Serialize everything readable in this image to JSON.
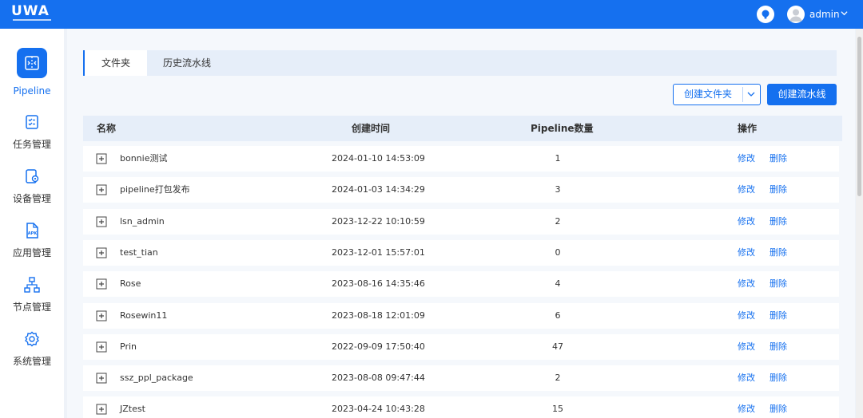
{
  "brand": {
    "logo_text": "UWA"
  },
  "header": {
    "user_name": "admin"
  },
  "sidebar": {
    "items": [
      {
        "label": "Pipeline",
        "icon": "pipeline-icon",
        "active": true
      },
      {
        "label": "任务管理",
        "icon": "task-list-icon",
        "active": false
      },
      {
        "label": "设备管理",
        "icon": "device-settings-icon",
        "active": false
      },
      {
        "label": "应用管理",
        "icon": "apk-file-icon",
        "active": false
      },
      {
        "label": "节点管理",
        "icon": "node-tree-icon",
        "active": false
      },
      {
        "label": "系统管理",
        "icon": "gear-icon",
        "active": false
      }
    ]
  },
  "tabs": [
    {
      "label": "文件夹",
      "active": true
    },
    {
      "label": "历史流水线",
      "active": false
    }
  ],
  "toolbar": {
    "create_folder_label": "创建文件夹",
    "create_pipeline_label": "创建流水线"
  },
  "table": {
    "headers": {
      "name": "名称",
      "created": "创建时间",
      "count": "Pipeline数量",
      "actions": "操作"
    },
    "edit_label": "修改",
    "delete_label": "删除",
    "rows": [
      {
        "name": "bonnie测试",
        "created": "2024-01-10 14:53:09",
        "count": "1"
      },
      {
        "name": "pipeline打包发布",
        "created": "2024-01-03 14:34:29",
        "count": "3"
      },
      {
        "name": "lsn_admin",
        "created": "2023-12-22 10:10:59",
        "count": "2"
      },
      {
        "name": "test_tian",
        "created": "2023-12-01 15:57:01",
        "count": "0"
      },
      {
        "name": "Rose",
        "created": "2023-08-16 14:35:46",
        "count": "4"
      },
      {
        "name": "Rosewin11",
        "created": "2023-08-18 12:01:09",
        "count": "6"
      },
      {
        "name": "Prin",
        "created": "2022-09-09 17:50:40",
        "count": "47"
      },
      {
        "name": "ssz_ppl_package",
        "created": "2023-08-08 09:47:44",
        "count": "2"
      },
      {
        "name": "JZtest",
        "created": "2023-04-24 10:43:28",
        "count": "15"
      }
    ]
  },
  "colors": {
    "primary": "#1570ef",
    "topbar": "#1570ef",
    "header_row": "#e6eef9"
  }
}
